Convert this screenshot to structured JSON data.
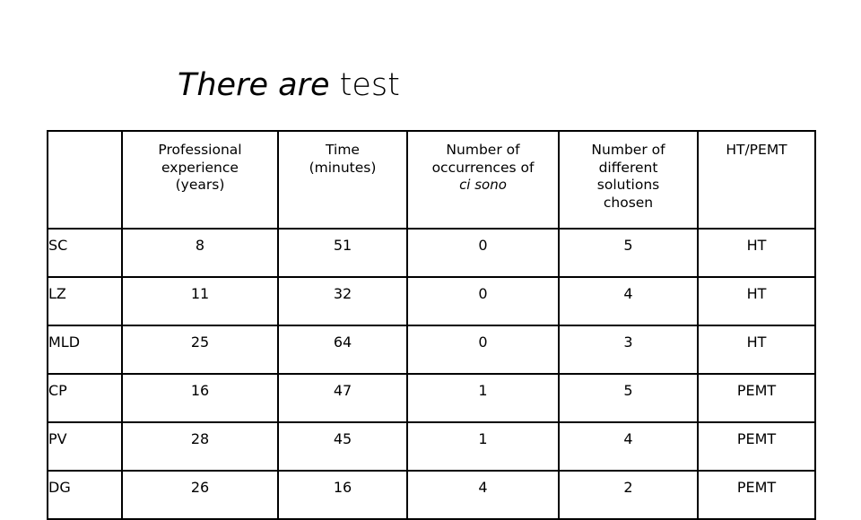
{
  "slide": {
    "title": {
      "italic_part": "There are",
      "regular_part": " test"
    },
    "background_color": "#ffffff",
    "text_color": "#000000",
    "border_color": "#000000"
  },
  "table": {
    "corner_header": "",
    "headers": [
      {
        "line1": "Professional",
        "line2": "experience",
        "line3": "(years)"
      },
      {
        "line1": "Time",
        "line2": "(minutes)",
        "line3": ""
      },
      {
        "line1": "Number of",
        "line2": "occurrences of",
        "line3": "ci sono"
      },
      {
        "line1": "Number of",
        "line2": "different",
        "line3": "solutions",
        "line4": "chosen"
      },
      {
        "line1": "HT/PEMT",
        "line2": "",
        "line3": ""
      }
    ],
    "header_plain": [
      "Professional experience (years)",
      "Time (minutes)",
      "Number of occurrences of ci sono",
      "Number of different solutions chosen",
      "HT/PEMT"
    ],
    "rows": [
      {
        "name": "SC",
        "experience": "8",
        "time": "51",
        "occurrences": "0",
        "solutions": "5",
        "type": "HT"
      },
      {
        "name": "LZ",
        "experience": "11",
        "time": "32",
        "occurrences": "0",
        "solutions": "4",
        "type": "HT"
      },
      {
        "name": "MLD",
        "experience": "25",
        "time": "64",
        "occurrences": "0",
        "solutions": "3",
        "type": "HT"
      },
      {
        "name": "CP",
        "experience": "16",
        "time": "47",
        "occurrences": "1",
        "solutions": "5",
        "type": "PEMT"
      },
      {
        "name": "PV",
        "experience": "28",
        "time": "45",
        "occurrences": "1",
        "solutions": "4",
        "type": "PEMT"
      },
      {
        "name": "DG",
        "experience": "26",
        "time": "16",
        "occurrences": "4",
        "solutions": "2",
        "type": "PEMT"
      }
    ]
  }
}
